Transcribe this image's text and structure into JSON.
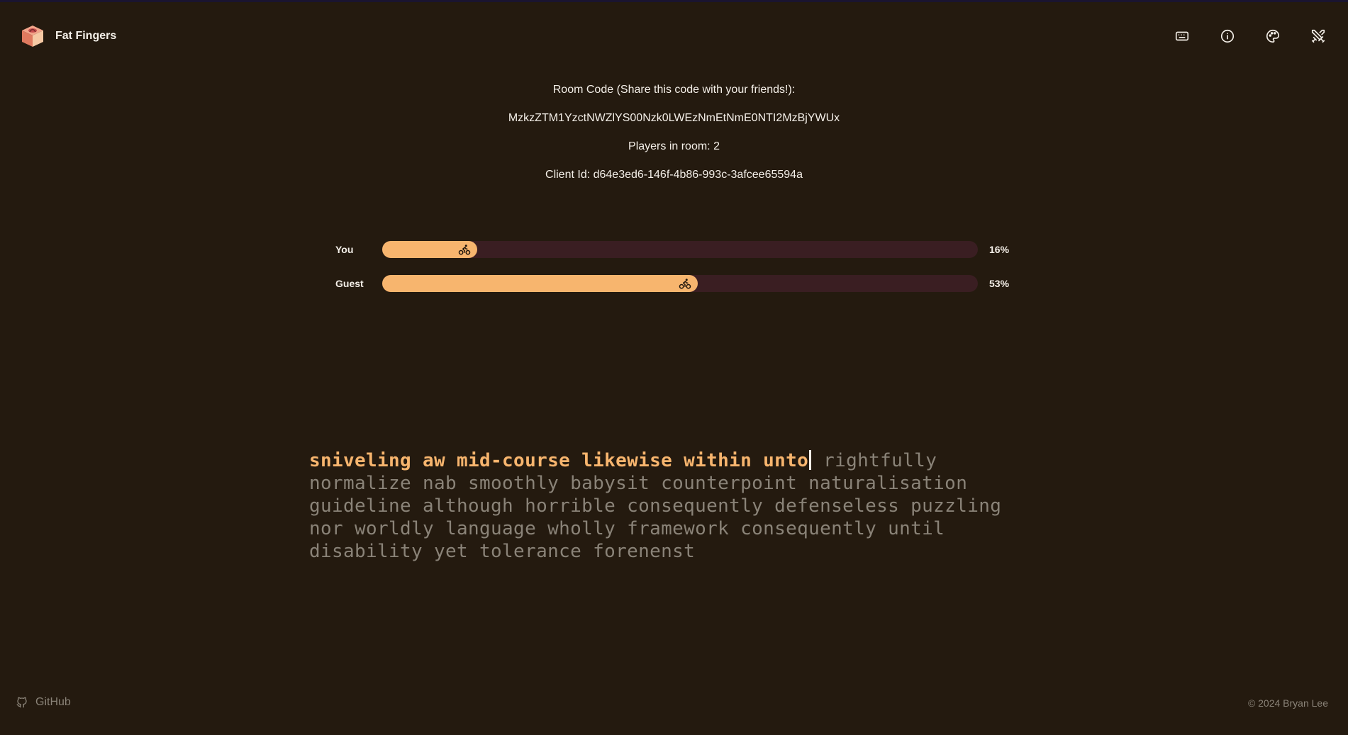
{
  "app": {
    "name": "Fat Fingers"
  },
  "header": {
    "icons": [
      "keyboard-icon",
      "info-icon",
      "palette-icon",
      "swords-icon"
    ]
  },
  "room": {
    "code_label": "Room Code (Share this code with your friends!):",
    "code": "MzkzZTM1YzctNWZlYS00Nzk0LWEzNmEtNmE0NTI2MzBjYWUx",
    "players": "Players in room: 2",
    "client_id": "Client Id: d64e3ed6-146f-4b86-993c-3afcee65594a"
  },
  "race": {
    "racers": [
      {
        "name": "You",
        "progress": 0.16,
        "percent_text": "16%"
      },
      {
        "name": "Guest",
        "progress": 0.53,
        "percent_text": "53%"
      }
    ]
  },
  "typing": {
    "typed": "sniveling aw mid-course likewise within unto",
    "remaining": " rightfully normalize nab smoothly babysit counterpoint naturalisation guideline although horrible consequently defenseless puzzling nor worldly language wholly framework consequently until disability yet tolerance forenenst"
  },
  "footer": {
    "github_label": "GitHub",
    "copyright": "© 2024 Bryan Lee"
  },
  "colors": {
    "background": "#241a0f",
    "accent": "#f7b56e",
    "track": "#3a1e22",
    "muted_text": "#8a8378"
  }
}
